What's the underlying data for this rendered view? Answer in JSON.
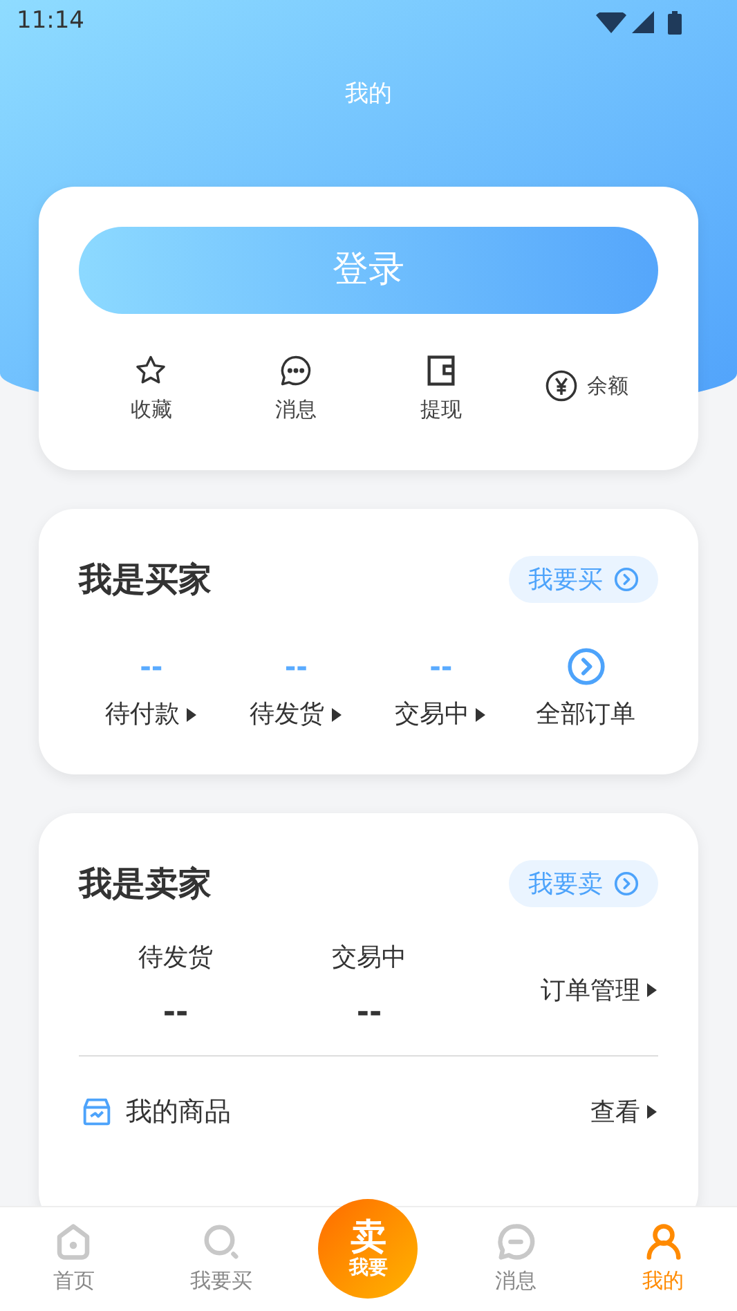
{
  "status_bar": {
    "time": "11:14"
  },
  "header": {
    "title": "我的"
  },
  "account": {
    "login_button": "登录",
    "shortcuts": [
      {
        "kind": "star",
        "label": "收藏"
      },
      {
        "kind": "chat",
        "label": "消息"
      },
      {
        "kind": "wallet",
        "label": "提现"
      },
      {
        "kind": "yuan",
        "label": "余额"
      }
    ]
  },
  "buyer": {
    "title": "我是买家",
    "action": "我要买",
    "orders": [
      {
        "kind": "count",
        "value": "--",
        "label": "待付款"
      },
      {
        "kind": "count",
        "value": "--",
        "label": "待发货"
      },
      {
        "kind": "count",
        "value": "--",
        "label": "交易中"
      },
      {
        "kind": "all",
        "label": "全部订单"
      }
    ]
  },
  "seller": {
    "title": "我是卖家",
    "action": "我要卖",
    "stats": [
      {
        "label": "待发货",
        "value": "--"
      },
      {
        "label": "交易中",
        "value": "--"
      }
    ],
    "manage_link": "订单管理",
    "goods": {
      "label": "我的商品",
      "link": "查看"
    }
  },
  "bottom_nav": [
    {
      "kind": "home",
      "label": "首页",
      "selected": false
    },
    {
      "kind": "search",
      "label": "我要买",
      "selected": false
    },
    {
      "kind": "sell",
      "label": "卖",
      "sublabel": "我要",
      "selected": false
    },
    {
      "kind": "chat",
      "label": "消息",
      "selected": false
    },
    {
      "kind": "user",
      "label": "我的",
      "selected": true
    }
  ]
}
